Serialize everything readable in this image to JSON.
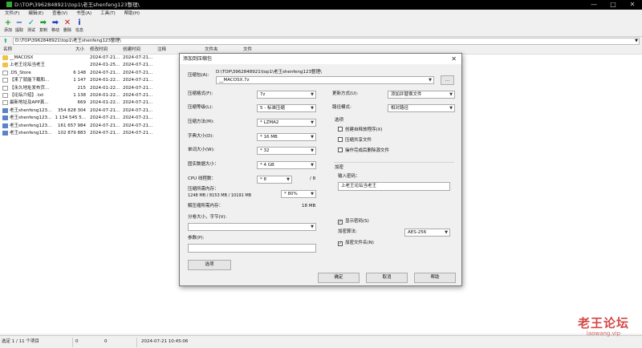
{
  "window": {
    "title": "D:\\TOP\\3962848921\\top1\\老王shenfeng123整理\\",
    "controls": {
      "minimize": "—",
      "maximize": "□",
      "close": "✕"
    }
  },
  "menu": [
    "文件(F)",
    "编辑(E)",
    "查看(V)",
    "书签(A)",
    "工具(T)",
    "帮助(H)"
  ],
  "toolbar": [
    {
      "label": "添加",
      "icon": "+",
      "color": "#1a9e2a"
    },
    {
      "label": "提取",
      "icon": "−",
      "color": "#1d3fbf"
    },
    {
      "label": "测试",
      "icon": "✓",
      "color": "#1d9e9e"
    },
    {
      "label": "复制",
      "icon": "➡",
      "color": "#1a9e2a"
    },
    {
      "label": "移动",
      "icon": "➡",
      "color": "#1d3fbf"
    },
    {
      "label": "删除",
      "icon": "✕",
      "color": "#c81e1e"
    },
    {
      "label": "信息",
      "icon": "i",
      "color": "#1d3fbf"
    }
  ],
  "address": "D:\\TOP\\3962848921\\top1\\老王shenfeng123整理\\",
  "columns": {
    "name": "名称",
    "size": "大小",
    "modified": "修改时间",
    "created": "创建时间",
    "comment": "注释",
    "folders": "文件夹",
    "files": "文件"
  },
  "files": [
    {
      "name": "__MACOSX",
      "size": "",
      "modified": "2024-07-21...",
      "created": "2024-07-21...",
      "type": "folder"
    },
    {
      "name": "上老王论坛当老王",
      "size": "",
      "modified": "2024-01-25...",
      "created": "2024-07-21...",
      "type": "folder"
    },
    {
      "name": ".DS_Store",
      "size": "6 148",
      "modified": "2024-07-21...",
      "created": "2024-07-21...",
      "type": "file"
    },
    {
      "name": "【来了就能下载和...",
      "size": "1 147",
      "modified": "2024-01-22...",
      "created": "2024-07-21...",
      "type": "file"
    },
    {
      "name": "【永久地址发布页...",
      "size": "215",
      "modified": "2024-01-22...",
      "created": "2024-07-21...",
      "type": "file"
    },
    {
      "name": "【论坛介绍】.txt",
      "size": "1 138",
      "modified": "2024-01-22...",
      "created": "2024-07-21...",
      "type": "file"
    },
    {
      "name": "最新地址及APP真...",
      "size": "669",
      "modified": "2024-01-22...",
      "created": "2024-07-21...",
      "type": "file"
    },
    {
      "name": "老王shenfeng123...",
      "size": "354 828 304",
      "modified": "2024-07-21...",
      "created": "2024-07-21...",
      "type": "rar"
    },
    {
      "name": "老王shenfeng123...",
      "size": "1 134 545 5...",
      "modified": "2024-07-21...",
      "created": "2024-07-21...",
      "type": "rar"
    },
    {
      "name": "老王shenfeng123...",
      "size": "161 657 984",
      "modified": "2024-07-21...",
      "created": "2024-07-21...",
      "type": "rar"
    },
    {
      "name": "老王shenfeng123...",
      "size": "102 879 883",
      "modified": "2024-07-21...",
      "created": "2024-07-21...",
      "type": "rar"
    }
  ],
  "status": {
    "selection": "选定 1 / 11 个项目",
    "v1": "0",
    "v2": "0",
    "datetime": "2024-07-21 10:45:06"
  },
  "watermark": {
    "big": "老王论坛",
    "small": "laowang.vip"
  },
  "dialog": {
    "title": "添加到压缩包",
    "close": "✕",
    "archive_label": "压缩包(A):",
    "archive_path": "D:\\TOP\\3962848921\\top1\\老王shenfeng123整理\\",
    "archive_name": "__MACOSX.7z",
    "browse": "...",
    "format_label": "压缩格式(F):",
    "format": "7z",
    "level_label": "压缩等级(L):",
    "level": "5 - 标准压缩",
    "method_label": "压缩方法(M):",
    "method": "* LZMA2",
    "dict_label": "字典大小(D):",
    "dict": "* 16 MB",
    "word_label": "单词大小(W):",
    "word": "* 32",
    "solid_label": "固实数据大小：",
    "solid": "* 4 GB",
    "cpu_label": "CPU 线程数：",
    "cpu": "* 8",
    "cpu_total": "/ 8",
    "mem_label": "压缩所需内存：",
    "mem_detail": "1248 MB / 8153 MB / 10191 MB",
    "mem_percent": "* 80%",
    "decomp_label": "解压缩所需内存：",
    "decomp": "18 MB",
    "split_label": "分卷大小，字节(V):",
    "split": "",
    "params_label": "参数(P):",
    "params": "",
    "options_btn": "选项",
    "update_label": "更新方式(U):",
    "update": "添加并替换文件",
    "pathmode_label": "路径模式:",
    "pathmode": "相对路径",
    "options_title": "选项",
    "opt_sfx": "创建自释放程序(X)",
    "opt_shared": "压缩共享文件",
    "opt_delete": "操作完成后删除源文件",
    "encrypt_title": "加密",
    "password_label": "输入密码：",
    "password": "上老王论坛当老王",
    "show_pw": "显示密码(S)",
    "enc_method_label": "加密算法:",
    "enc_method": "AES-256",
    "enc_names": "加密文件名(N)",
    "ok": "确定",
    "cancel": "取消",
    "help": "帮助"
  }
}
